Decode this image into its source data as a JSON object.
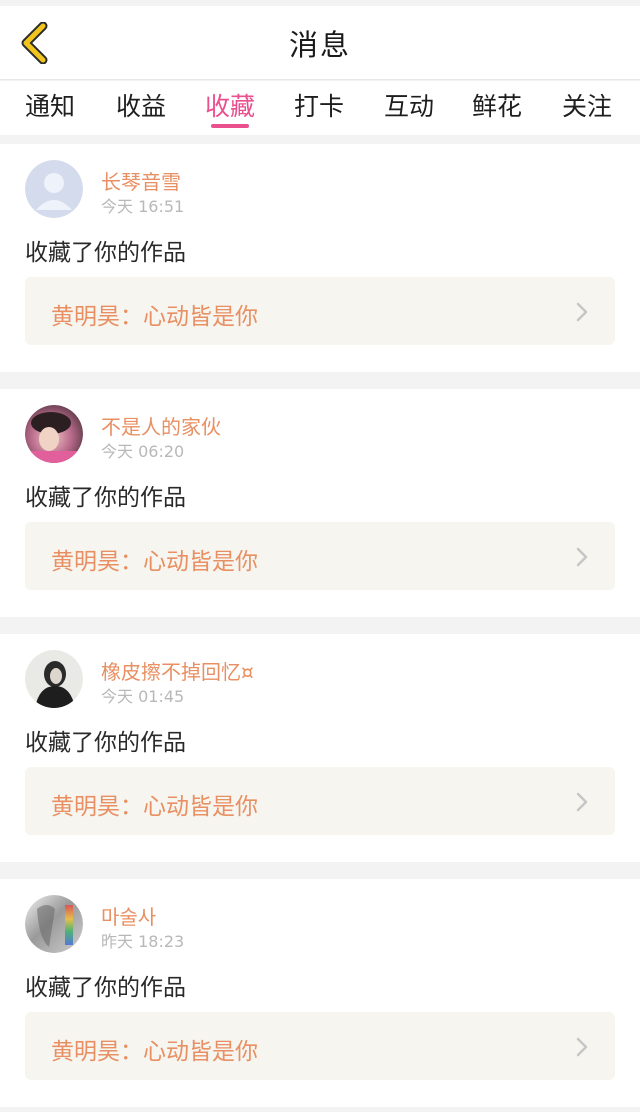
{
  "header": {
    "title": "消息",
    "back_icon": "chevron-left-icon",
    "back_color": "#f2c51c"
  },
  "tabs": [
    {
      "label": "通知"
    },
    {
      "label": "收益"
    },
    {
      "label": "收藏",
      "active": true
    },
    {
      "label": "打卡"
    },
    {
      "label": "互动"
    },
    {
      "label": "鲜花"
    },
    {
      "label": "关注"
    }
  ],
  "colors": {
    "accent": "#ea4f8e",
    "username": "#e89063",
    "back": "#f2c51c"
  },
  "messages": [
    {
      "username": "长琴音雪",
      "time": "今天 16:51",
      "action": "收藏了你的作品",
      "work": "黄明昊：心动皆是你",
      "avatar": "default-avatar-icon"
    },
    {
      "username": "不是人的家伙",
      "time": "今天 06:20",
      "action": "收藏了你的作品",
      "work": "黄明昊：心动皆是你",
      "avatar": "user-photo-avatar"
    },
    {
      "username": "橡皮擦不掉回忆¤",
      "time": "今天 01:45",
      "action": "收藏了你的作品",
      "work": "黄明昊：心动皆是你",
      "avatar": "user-photo-avatar"
    },
    {
      "username": "마술사",
      "time": "昨天 18:23",
      "action": "收藏了你的作品",
      "work": "黄明昊：心动皆是你",
      "avatar": "user-photo-avatar"
    }
  ]
}
